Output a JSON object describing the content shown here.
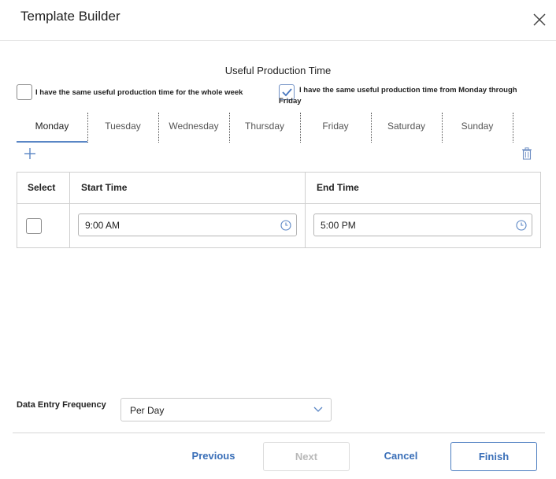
{
  "dialog": {
    "title": "Template Builder"
  },
  "section": {
    "title": "Useful Production Time"
  },
  "options": {
    "whole_week": {
      "label": "I have the same useful production time for the whole week",
      "checked": false
    },
    "weekdays": {
      "label": "I have the same useful production time from Monday through Friday",
      "checked": true
    }
  },
  "tabs": [
    {
      "label": "Monday",
      "active": true
    },
    {
      "label": "Tuesday"
    },
    {
      "label": "Wednesday"
    },
    {
      "label": "Thursday"
    },
    {
      "label": "Friday"
    },
    {
      "label": "Saturday"
    },
    {
      "label": "Sunday"
    }
  ],
  "grid": {
    "headers": {
      "select": "Select",
      "start": "Start Time",
      "end": "End Time"
    },
    "rows": [
      {
        "start": "9:00 AM",
        "end": "5:00 PM",
        "selected": false
      }
    ]
  },
  "frequency": {
    "label": "Data Entry Frequency",
    "value": "Per Day"
  },
  "footer": {
    "previous": "Previous",
    "next": "Next",
    "cancel": "Cancel",
    "finish": "Finish"
  },
  "colors": {
    "accent": "#3a6fb8",
    "tab_underline": "#5a86c5",
    "disabled": "#b9b9b9"
  },
  "icons": {
    "close": "close-icon",
    "add": "plus-icon",
    "delete": "trash-icon",
    "clock": "clock-icon",
    "dropdown": "chevron-down-icon",
    "check": "checkmark-icon"
  }
}
